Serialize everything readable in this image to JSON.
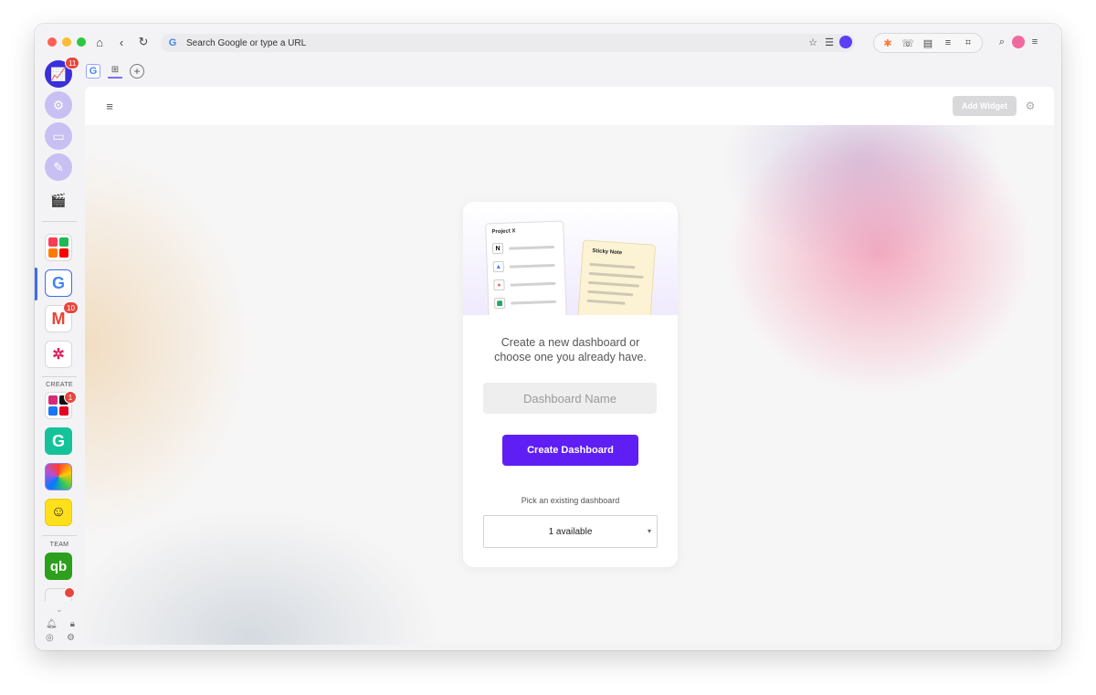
{
  "browser": {
    "url_placeholder": "Search Google or type a URL",
    "traffic_lights": [
      "#ff5f57",
      "#febc2e",
      "#28c840"
    ]
  },
  "sidebar": {
    "badges": {
      "analytics": "11",
      "gmail": "10",
      "social": "1"
    },
    "section_create": "CREATE",
    "section_team": "TEAM"
  },
  "header": {
    "add_widget": "Add Widget"
  },
  "card": {
    "illustration": {
      "project_title": "Project X",
      "sticky_title": "Sticky Note"
    },
    "prompt": "Create a new dashboard or choose one you already have.",
    "name_placeholder": "Dashboard Name",
    "create_button": "Create Dashboard",
    "pick_label": "Pick an existing dashboard",
    "select_value": "1 available"
  },
  "colors": {
    "accent": "#5f1ff4",
    "badge": "#e8453c"
  }
}
